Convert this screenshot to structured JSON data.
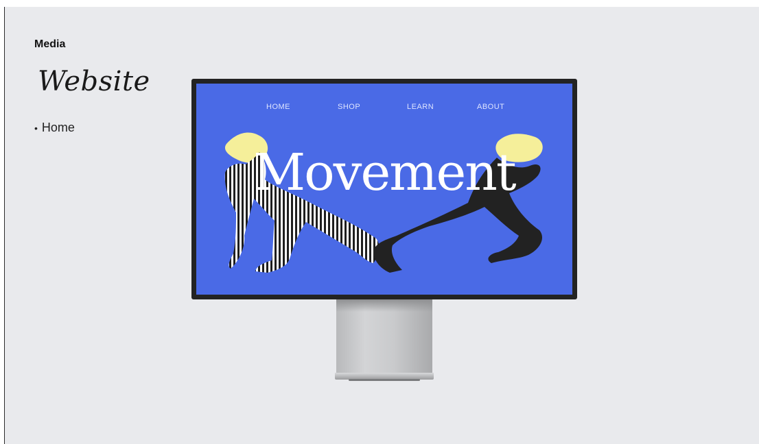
{
  "slide": {
    "section_label": "Media",
    "title": "Website",
    "bullets": [
      "Home"
    ]
  },
  "mockup": {
    "nav": [
      "HOME",
      "SHOP",
      "LEARN",
      "ABOUT"
    ],
    "hero_word": "Movement",
    "colors": {
      "screen_bg": "#4a6ae6",
      "bezel": "#232323",
      "hair": "#f5ef9a",
      "figure_dark": "#222222",
      "stand": "#c4c5c7"
    }
  }
}
